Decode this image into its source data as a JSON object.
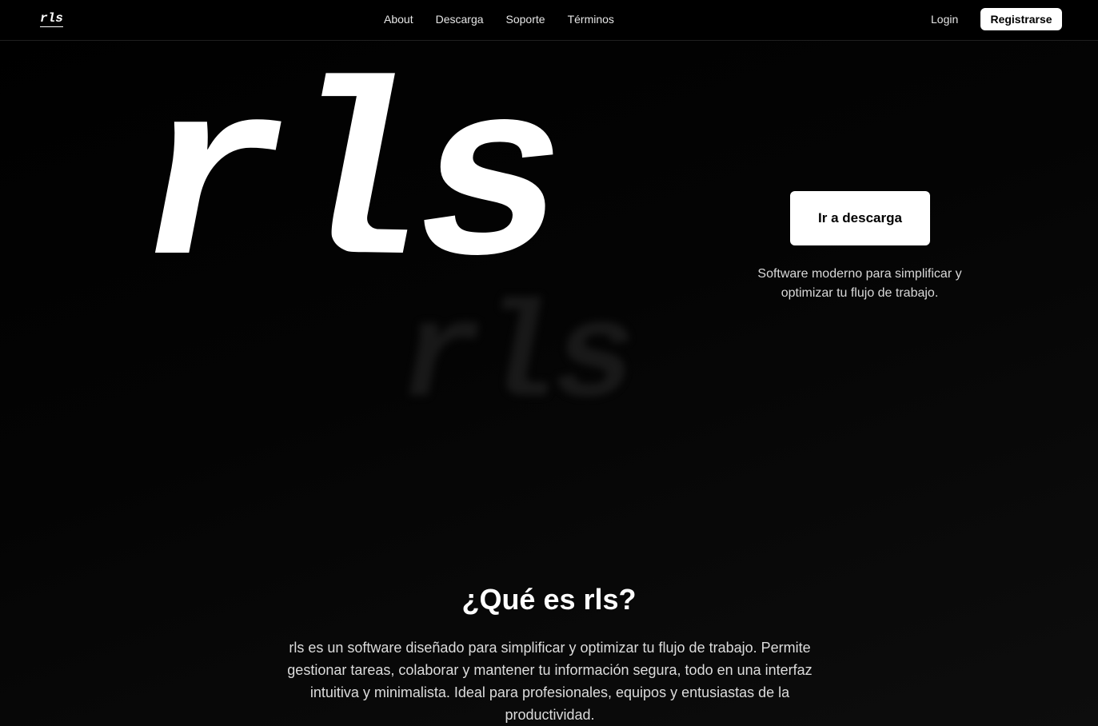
{
  "nav": {
    "logo": "rls",
    "links": [
      "About",
      "Descarga",
      "Soporte",
      "Términos"
    ],
    "login": "Login",
    "register": "Registrarse"
  },
  "hero": {
    "word": "rls",
    "shadow_word": "rls",
    "cta": "Ir a descarga",
    "tagline": "Software moderno para simplificar y optimizar tu flujo de trabajo."
  },
  "about": {
    "title": "¿Qué es rls?",
    "text": "rls es un software diseñado para simplificar y optimizar tu flujo de trabajo. Permite gestionar tareas, colaborar y mantener tu información segura, todo en una interfaz intuitiva y minimalista. Ideal para profesionales, equipos y entusiastas de la productividad."
  },
  "colors": {
    "background": "#000000",
    "text": "#ffffff",
    "button_bg": "#ffffff",
    "button_text": "#000000"
  }
}
